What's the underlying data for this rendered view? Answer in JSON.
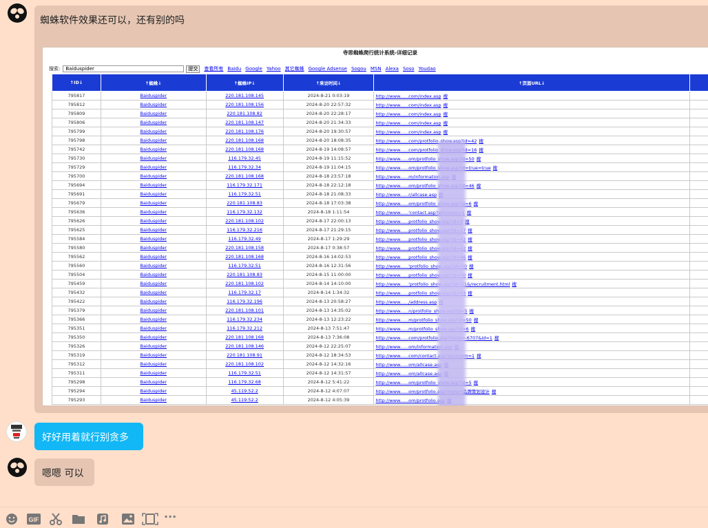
{
  "messages": {
    "first": "蜘蛛软件效果还可以，还有别的吗",
    "second": "好好用着就行别贪多",
    "third": "嗯嗯 可以"
  },
  "screenshot": {
    "title": "寺思蜘蛛爬行统计系统-详细记录",
    "search_label": "搜索:",
    "search_value": "Baiduspider",
    "submit_label": "提交",
    "engines": [
      "查看所有",
      "Baidu",
      "Google",
      "Yahoo",
      "其它蜘蛛",
      "Google Adsense",
      "Sogou",
      "MSN",
      "Alexa",
      "Soso",
      "Youdao"
    ],
    "columns": [
      "↑ID↓",
      "↑蜘蛛↓",
      "↑蜘蛛IP↓",
      "↑来访时间↓",
      "↑页面URL↓"
    ],
    "action_label": "搜",
    "rows": [
      [
        "795817",
        "Baiduspider",
        "220.181.108.145",
        "2024-8-21 0:03:19",
        "http://www......com/index.asp"
      ],
      [
        "795812",
        "Baiduspider",
        "220.181.108.156",
        "2024-8-20 22:57:32",
        "http://www......com/index.asp"
      ],
      [
        "795809",
        "Baiduspider",
        "220.181.108.82",
        "2024-8-20 22:28:17",
        "http://www......com/index.asp"
      ],
      [
        "795806",
        "Baiduspider",
        "220.181.108.147",
        "2024-8-20 21:34:33",
        "http://www......com/index.asp"
      ],
      [
        "795799",
        "Baiduspider",
        "220.181.108.176",
        "2024-8-20 19:30:57",
        "http://www......com/index.asp"
      ],
      [
        "795798",
        "Baiduspider",
        "220.181.108.168",
        "2024-8-20 18:08:35",
        "http://www......com/protfolio_show.asp?id=42"
      ],
      [
        "795742",
        "Baiduspider",
        "220.181.108.168",
        "2024-8-19 14:08:57",
        "http://www......com/protfolio_show.asp?id=16"
      ],
      [
        "795730",
        "Baiduspider",
        "116.179.32.45",
        "2024-8-19 11:15:52",
        "http://www......om/protfolio_show.asp?id=50"
      ],
      [
        "795729",
        "Baiduspider",
        "116.179.32.34",
        "2024-8-19 11:04:15",
        "http://www......om/protfolio_show.asp?id=true=true"
      ],
      [
        "795700",
        "Baiduspider",
        "220.181.108.168",
        "2024-8-18 23:57:18",
        "http://www......m/information.asp"
      ],
      [
        "795694",
        "Baiduspider",
        "116.179.32.171",
        "2024-8-18 22:12:18",
        "http://www......om/protfolio_show.asp?id=46"
      ],
      [
        "795691",
        "Baiduspider",
        "116.179.32.51",
        "2024-8-18 21:08:33",
        "http://www......r/allcase.asp"
      ],
      [
        "795679",
        "Baiduspider",
        "220.181.108.83",
        "2024-8-18 17:03:38",
        "http://www......om/protfolio_show.asp?id=6"
      ],
      [
        "795636",
        "Baiduspider",
        "116.179.32.132",
        "2024-8-18 1:11:54",
        "http://www......'contact.asp?winzoom=1"
      ],
      [
        "795626",
        "Baiduspider",
        "220.181.108.102",
        "2024-8-17 22:00:13",
        "http://www......protfolio_show.asp?id=3"
      ],
      [
        "795625",
        "Baiduspider",
        "116.179.32.216",
        "2024-8-17 21:29:15",
        "http://www......protfolio_show.asp?id=17"
      ],
      [
        "795584",
        "Baiduspider",
        "116.179.32.49",
        "2024-8-17 1:29:29",
        "http://www......protfolio_show.asp?id=42"
      ],
      [
        "795580",
        "Baiduspider",
        "220.181.108.158",
        "2024-8-17 0:38:57",
        "http://www......protfolio_show.asp?id=42"
      ],
      [
        "795562",
        "Baiduspider",
        "220.181.108.168",
        "2024-8-16 14:02:53",
        "http://www......protfolio_show.asp?id=46"
      ],
      [
        "795560",
        "Baiduspider",
        "116.179.32.51",
        "2024-8-16 12:31:56",
        "http://www......'protfolio_show.asp?id=50"
      ],
      [
        "795504",
        "Baiduspider",
        "220.181.108.83",
        "2024-8-15 11:00:00",
        "http://www......protfolio_show.asp?id=50"
      ],
      [
        "795459",
        "Baiduspider",
        "220.181.108.102",
        "2024-8-14 14:10:00",
        "http://www......'protfolio_show.asp?id=51&/recruitment.html"
      ],
      [
        "795432",
        "Baiduspider",
        "116.179.32.17",
        "2024-8-14 1:34:32",
        "http://www......protfolio_show.asp?id=43"
      ],
      [
        "795422",
        "Baiduspider",
        "116.179.32.196",
        "2024-8-13 20:58:27",
        "http://www....../address.asp"
      ],
      [
        "795379",
        "Baiduspider",
        "220.181.108.101",
        "2024-8-13 14:35:02",
        "http://www......n/protfolio_show.asp?id=5"
      ],
      [
        "795366",
        "Baiduspider",
        "116.179.32.234",
        "2024-8-13 12:23:22",
        "http://www......m/protfolio_show.asp?id=50"
      ],
      [
        "795351",
        "Baiduspider",
        "116.179.32.212",
        "2024-8-13 7:51:47",
        "http://www......m/protfolio_show.asp?id=6"
      ],
      [
        "795350",
        "Baiduspider",
        "220.181.108.168",
        "2024-8-13 7:36:08",
        "http://www......com/protfolio.asp?more=-6707&id=1"
      ],
      [
        "795326",
        "Baiduspider",
        "220.181.108.146",
        "2024-8-12 22:25:07",
        "http://www......om/information.asp"
      ],
      [
        "795319",
        "Baiduspider",
        "220.181.108.91",
        "2024-8-12 18:34:53",
        "http://www......com/contact.asp?winzoom=1"
      ],
      [
        "795312",
        "Baiduspider",
        "220.181.108.102",
        "2024-8-12 14:32:16",
        "http://www......om/allcase.asp"
      ],
      [
        "795311",
        "Baiduspider",
        "116.179.32.51",
        "2024-8-12 14:31:57",
        "http://www......om/allcase.asp"
      ],
      [
        "795298",
        "Baiduspider",
        "116.179.32.68",
        "2024-8-12 5:41:22",
        "http://www......om/protfolio_show.asp?id=5"
      ],
      [
        "795294",
        "Baiduspider",
        "45.119.52.2",
        "2024-8-12 4:07:07",
        "http://www......om/protfolio.asp?more=品牌策划设计"
      ],
      [
        "795293",
        "Baiduspider",
        "45.119.52.2",
        "2024-8-12 4:05:39",
        "http://www......om/protfolio.asp"
      ]
    ]
  },
  "toolbar": {
    "icons": [
      "emoji-icon",
      "gif-icon",
      "scissors-icon",
      "folder-icon",
      "music-icon",
      "image-icon",
      "screen-record-icon",
      "more-icon"
    ],
    "gif_label": "GIF",
    "more_label": "···"
  }
}
